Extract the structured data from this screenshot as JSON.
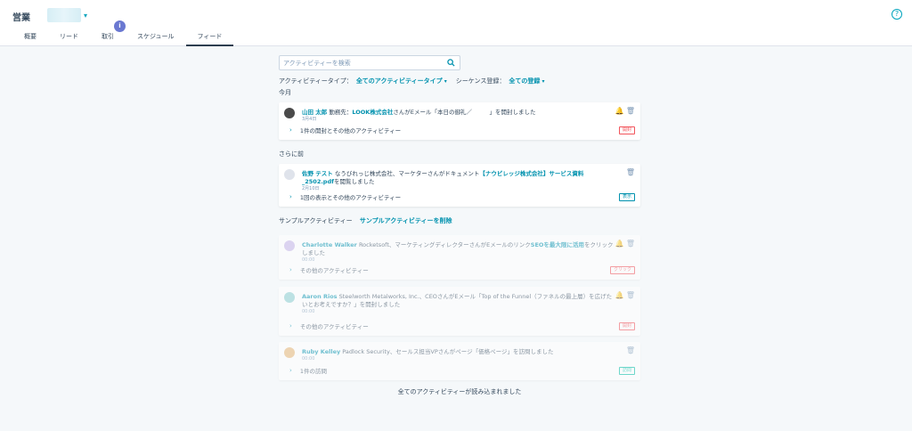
{
  "header": {
    "title": "営業",
    "tabs": [
      {
        "label": "概要"
      },
      {
        "label": "リード"
      },
      {
        "label": "取引"
      },
      {
        "label": "スケジュール"
      },
      {
        "label": "フィード"
      }
    ],
    "tab_badge": "i",
    "help": "?"
  },
  "search": {
    "placeholder": "アクティビティーを検索"
  },
  "filters": {
    "type_label": "アクティビティータイプ：",
    "type_value": "全てのアクティビティータイプ",
    "seq_label": "シーケンス登録：",
    "seq_value": "全ての登録"
  },
  "sections": {
    "this_month": "今月",
    "earlier": "さらに前",
    "sample_label": "サンプルアクティビティー",
    "sample_delete": "サンプルアクティビティーを削除"
  },
  "cards": [
    {
      "actor": "山田 太郎",
      "pre": " 勤務先：",
      "company": "LOOK株式会社",
      "post": "さんがEメール「本日の御礼／　　　」を開封しました",
      "date": "3月4日",
      "footer": "1件の開封とその他のアクティビティー",
      "tag": "開封",
      "tag_color": "#f2545b"
    },
    {
      "actor": "佐野 テスト",
      "pre": " なうびれっじ株式会社、マーケターさんがドキュメント",
      "company": "【ナウビレッジ株式会社】サービス資料_2502.pdf",
      "post": "を閲覧しました",
      "date": "2月10日",
      "footer": "1回の表示とその他のアクティビティー",
      "tag": "表示",
      "tag_color": "#0091ae"
    },
    {
      "actor": "Charlotte Walker",
      "pre": " Rocketsoft、マーケティングディレクターさんがEメールのリンク",
      "company": "SEOを最大限に活用",
      "post": "をクリックしました",
      "date": "00:00",
      "footer": "その他のアクティビティー",
      "tag": "クリック",
      "tag_color": "#f2545b"
    },
    {
      "actor": "Aaron Rios",
      "pre": " Steelworth Metalworks, Inc.、CEOさんがEメール「Top of the Funnel（ファネルの最上層）を広げたいとお考えですか？」を開封しました",
      "company": "",
      "post": "",
      "date": "00:00",
      "footer": "その他のアクティビティー",
      "tag": "開封",
      "tag_color": "#f2545b"
    },
    {
      "actor": "Ruby Kelley",
      "pre": " Padlock Security、セールス担当VPさんがページ「価格ページ」を訪問しました",
      "company": "",
      "post": "",
      "date": "00:00",
      "footer": "1件の訪問",
      "tag": "訪問",
      "tag_color": "#00bda5"
    }
  ],
  "end_message": "全てのアクティビティーが読み込まれました"
}
